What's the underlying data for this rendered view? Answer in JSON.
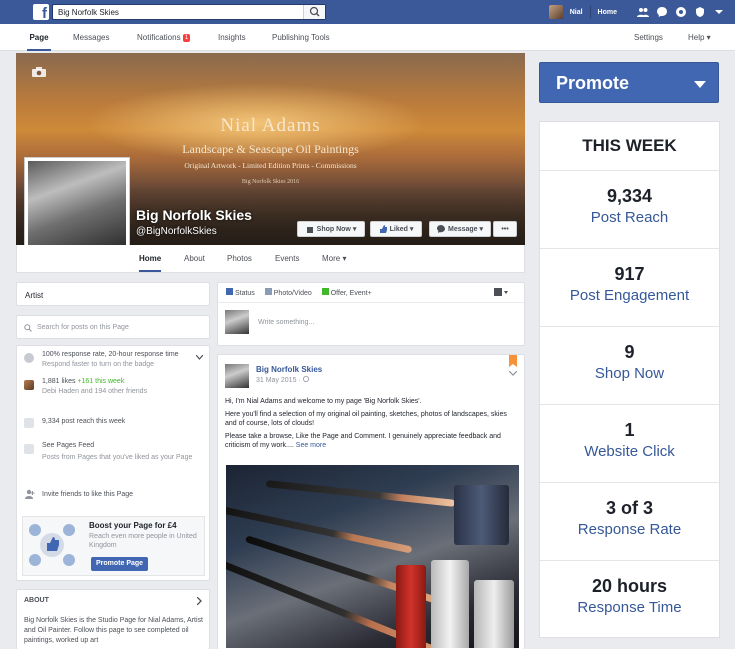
{
  "topbar": {
    "search_value": "Big Norfolk Skies",
    "user_name": "Nial",
    "home_label": "Home"
  },
  "subnav": {
    "page": "Page",
    "messages": "Messages",
    "notifications": "Notifications",
    "notifications_count": "1",
    "insights": "Insights",
    "publishing_tools": "Publishing Tools",
    "settings": "Settings",
    "help": "Help ▾"
  },
  "cover": {
    "artist": "Nial Adams",
    "tagline": "Landscape & Seascape Oil Paintings",
    "subline": "Original Artwork  -  Limited Edition Prints  -  Commissions",
    "small": "Big Norfolk Skies 2016",
    "page_name": "Big Norfolk Skies",
    "handle": "@BigNorfolkSkies",
    "shop_now": "Shop Now ▾",
    "liked": "Liked ▾",
    "message": "Message ▾",
    "more": "•••"
  },
  "tabs": {
    "home": "Home",
    "about": "About",
    "photos": "Photos",
    "events": "Events",
    "more": "More ▾"
  },
  "left": {
    "category": "Artist",
    "search_placeholder": "Search for posts on this Page",
    "response_title": "100% response rate, 20-hour response time",
    "response_sub": "Respond faster to turn on the badge",
    "likes": "1,881 likes",
    "likes_week": "+161 this week",
    "friends": "Debi Haden and 194 other friends",
    "reach": "9,334 post reach this week",
    "feed_title": "See Pages Feed",
    "feed_sub": "Posts from Pages that you've liked as your Page",
    "invite": "Invite friends to like this Page",
    "boost_title": "Boost your Page for £4",
    "boost_sub": "Reach even more people in United Kingdom",
    "promote_page": "Promote Page",
    "about_head": "ABOUT",
    "about_text": "Big Norfolk Skies is the Studio Page for Nial Adams, Artist and Oil Painter. Follow this page to see completed oil paintings, worked up art"
  },
  "composer": {
    "status": "Status",
    "photo": "Photo/Video",
    "offer": "Offer, Event+",
    "placeholder": "Write something..."
  },
  "post": {
    "author": "Big Norfolk Skies",
    "date": "31 May 2015 · ",
    "line1": "Hi, I'm Nial Adams and welcome to my page 'Big Norfolk Skies'.",
    "line2": "Here you'll find a selection of my original oil painting, sketches, photos of landscapes, skies and of course, lots of clouds!",
    "line3": "Please take a browse, Like the Page and Comment. I genuinely appreciate feedback and criticism of my work.... ",
    "see_more": "See more"
  },
  "right": {
    "promote": "Promote",
    "week_title": "THIS WEEK",
    "stats": [
      {
        "value": "9,334",
        "label": "Post Reach"
      },
      {
        "value": "917",
        "label": "Post Engagement"
      },
      {
        "value": "9",
        "label": "Shop Now"
      },
      {
        "value": "1",
        "label": "Website Click"
      },
      {
        "value": "3 of 3",
        "label": "Response Rate"
      },
      {
        "value": "20 hours",
        "label": "Response Time"
      }
    ]
  },
  "colors": {
    "brand": "#3b5998",
    "promote": "#4267b2",
    "link": "#365899",
    "likes_green": "#42b72a"
  }
}
